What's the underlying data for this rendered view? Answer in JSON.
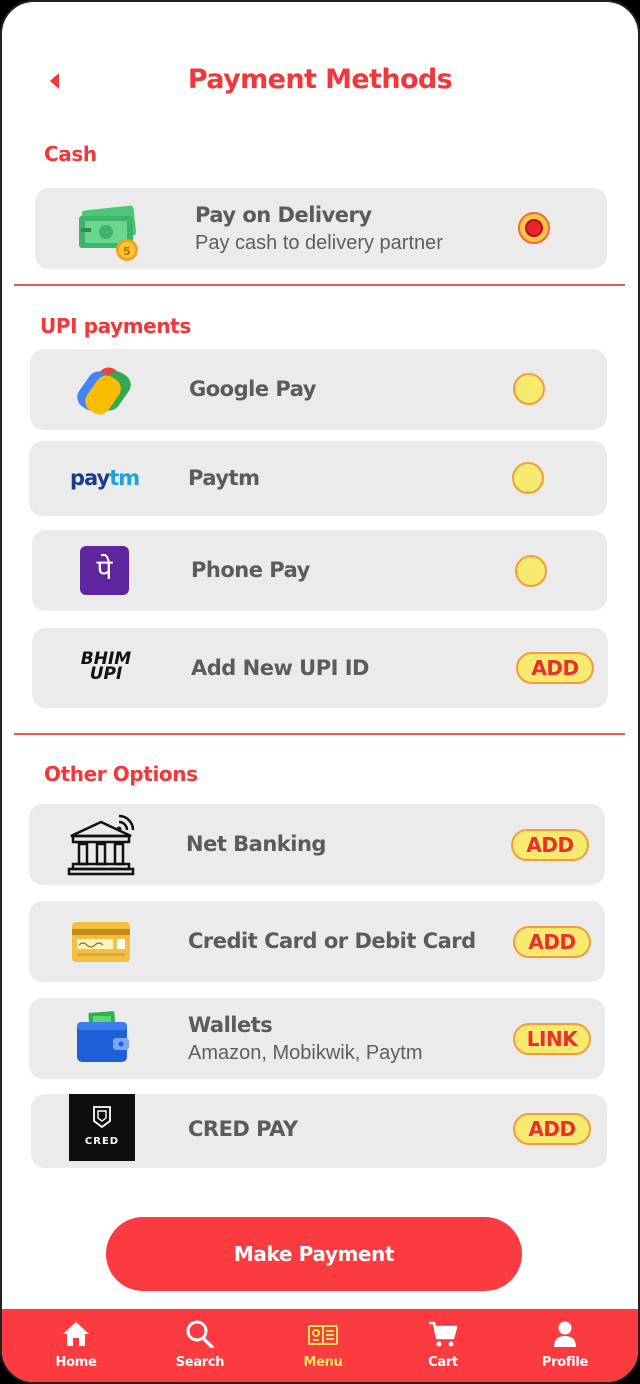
{
  "header": {
    "title": "Payment Methods",
    "back_icon": "back-arrow-icon"
  },
  "sections": {
    "cash": "Cash",
    "upi": "UPI payments",
    "other": "Other Options"
  },
  "cash": {
    "label": "Pay on Delivery",
    "sub": "Pay cash to delivery partner",
    "icon": "cash-icon",
    "selected": true
  },
  "upi": [
    {
      "label": "Google Pay",
      "icon": "google-pay-icon"
    },
    {
      "label": "Paytm",
      "icon": "paytm-icon",
      "logo_text_1": "pay",
      "logo_text_2": "tm"
    },
    {
      "label": "Phone Pay",
      "icon": "phonepe-icon",
      "logo_text": "पे"
    },
    {
      "label": "Add New UPI ID",
      "icon": "bhim-upi-icon",
      "action": "ADD",
      "logo_text_1": "BHIM",
      "logo_text_2": "UPI"
    }
  ],
  "other": [
    {
      "label": "Net Banking",
      "icon": "bank-icon",
      "action": "ADD"
    },
    {
      "label": "Credit Card or Debit Card",
      "icon": "credit-card-icon",
      "action": "ADD"
    },
    {
      "label": "Wallets",
      "sub": "Amazon, Mobikwik, Paytm",
      "icon": "wallet-icon",
      "action": "LINK"
    },
    {
      "label": "CRED PAY",
      "icon": "cred-icon",
      "action": "ADD",
      "logo_text": "CRED"
    }
  ],
  "make_payment": "Make Payment",
  "nav": [
    {
      "label": "Home",
      "icon": "home-icon"
    },
    {
      "label": "Search",
      "icon": "search-icon"
    },
    {
      "label": "Menu",
      "icon": "menu-icon",
      "active": true
    },
    {
      "label": "Cart",
      "icon": "cart-icon"
    },
    {
      "label": "Profile",
      "icon": "profile-icon"
    }
  ],
  "colors": {
    "accent": "#f0373a",
    "card": "#ebebeb",
    "nav": "#fb3b3f",
    "active_nav": "#ffe45c"
  }
}
